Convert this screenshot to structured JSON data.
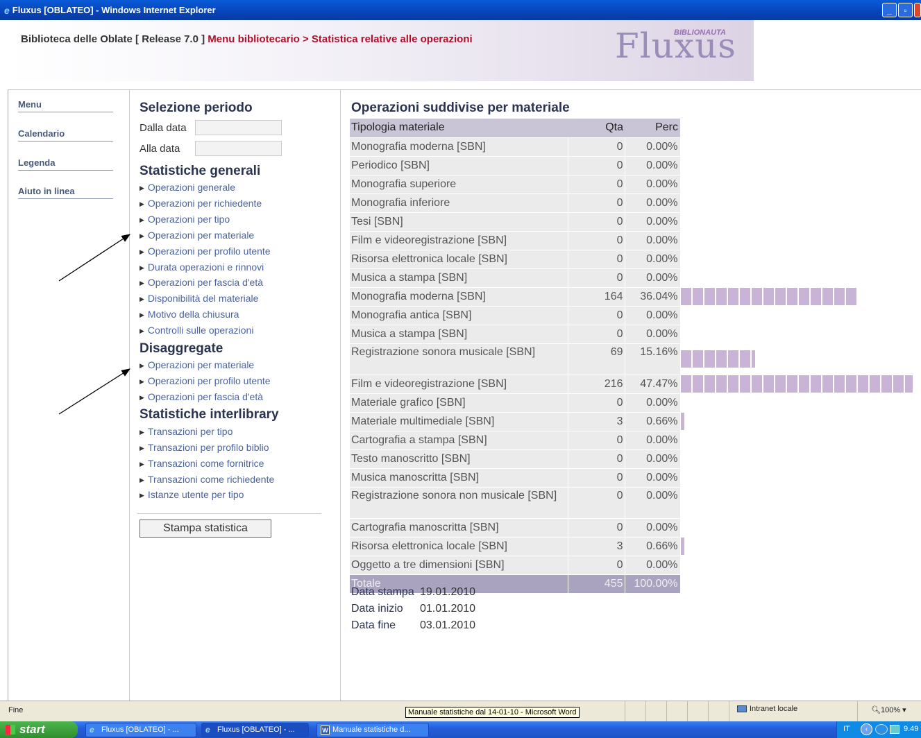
{
  "window": {
    "title": "Fluxus [OBLATEO] - Windows Internet Explorer",
    "minimize_label": "_",
    "maximize_label": "▫"
  },
  "header": {
    "crumb_black": "Biblioteca delle Oblate [ Release 7.0 ]",
    "crumb_red": "Menu bibliotecario > Statistica relative alle operazioni",
    "logo_text": "Fluxus",
    "logo_sub": "BIBLIONAUTA"
  },
  "sidebar": {
    "items": [
      {
        "label": "Menu"
      },
      {
        "label": "Calendario"
      },
      {
        "label": "Legenda"
      },
      {
        "label": "Aiuto in linea"
      }
    ]
  },
  "nav": {
    "periodo": {
      "title": "Selezione periodo",
      "dalla_label": "Dalla data",
      "dalla_value": "",
      "alla_label": "Alla data",
      "alla_value": ""
    },
    "generali": {
      "title": "Statistiche generali",
      "links": [
        "Operazioni generale",
        "Operazioni per richiedente",
        "Operazioni per tipo",
        "Operazioni per materiale",
        "Operazioni per profilo utente",
        "Durata operazioni e rinnovi",
        "Operazioni per fascia d'età",
        "Disponibilità del materiale",
        "Motivo della chiusura",
        "Controlli sulle operazioni"
      ]
    },
    "disaggregate": {
      "title": "Disaggregate",
      "links": [
        "Operazioni per materiale",
        "Operazioni per profilo utente",
        "Operazioni per fascia d'età"
      ]
    },
    "interlibrary": {
      "title": "Statistiche interlibrary",
      "links": [
        "Transazioni per tipo",
        "Transazioni per profilo biblio",
        "Transazioni come fornitrice",
        "Transazioni come richiedente",
        "Istanze utente per tipo"
      ]
    },
    "print_button": "Stampa statistica"
  },
  "content": {
    "title": "Operazioni suddivise per materiale",
    "columns": [
      "Tipologia materiale",
      "Qta",
      "Perc"
    ],
    "rows": [
      {
        "name": "Monografia moderna [SBN]",
        "qta": "0",
        "perc": "0.00%",
        "bar": 0
      },
      {
        "name": "Periodico [SBN]",
        "qta": "0",
        "perc": "0.00%",
        "bar": 0
      },
      {
        "name": "Monografia superiore",
        "qta": "0",
        "perc": "0.00%",
        "bar": 0
      },
      {
        "name": "Monografia inferiore",
        "qta": "0",
        "perc": "0.00%",
        "bar": 0
      },
      {
        "name": "Tesi [SBN]",
        "qta": "0",
        "perc": "0.00%",
        "bar": 0
      },
      {
        "name": "Film e videoregistrazione [SBN]",
        "qta": "0",
        "perc": "0.00%",
        "bar": 0
      },
      {
        "name": "Risorsa elettronica locale [SBN]",
        "qta": "0",
        "perc": "0.00%",
        "bar": 0
      },
      {
        "name": "Musica a stampa [SBN]",
        "qta": "0",
        "perc": "0.00%",
        "bar": 0
      },
      {
        "name": "Monografia moderna [SBN]",
        "qta": "164",
        "perc": "36.04%",
        "bar": 36.04
      },
      {
        "name": "Monografia antica [SBN]",
        "qta": "0",
        "perc": "0.00%",
        "bar": 0
      },
      {
        "name": "Musica a stampa [SBN]",
        "qta": "0",
        "perc": "0.00%",
        "bar": 0
      },
      {
        "name": "Registrazione sonora musicale [SBN]",
        "qta": "69",
        "perc": "15.16%",
        "bar": 15.16
      },
      {
        "name": "Film e videoregistrazione [SBN]",
        "qta": "216",
        "perc": "47.47%",
        "bar": 47.47
      },
      {
        "name": "Materiale grafico [SBN]",
        "qta": "0",
        "perc": "0.00%",
        "bar": 0
      },
      {
        "name": "Materiale multimediale [SBN]",
        "qta": "3",
        "perc": "0.66%",
        "bar": 0.66
      },
      {
        "name": "Cartografia a stampa [SBN]",
        "qta": "0",
        "perc": "0.00%",
        "bar": 0
      },
      {
        "name": "Testo manoscritto [SBN]",
        "qta": "0",
        "perc": "0.00%",
        "bar": 0
      },
      {
        "name": "Musica manoscritta [SBN]",
        "qta": "0",
        "perc": "0.00%",
        "bar": 0
      },
      {
        "name": "Registrazione sonora non musicale [SBN]",
        "qta": "0",
        "perc": "0.00%",
        "bar": 0
      },
      {
        "name": "Cartografia manoscritta [SBN]",
        "qta": "0",
        "perc": "0.00%",
        "bar": 0
      },
      {
        "name": "Risorsa elettronica locale [SBN]",
        "qta": "3",
        "perc": "0.66%",
        "bar": 0.66
      },
      {
        "name": "Oggetto a tre dimensioni [SBN]",
        "qta": "0",
        "perc": "0.00%",
        "bar": 0
      }
    ],
    "total": {
      "name": "Totale",
      "qta": "455",
      "perc": "100.00%"
    },
    "meta": [
      {
        "key": "Data stampa",
        "value": "19.01.2010"
      },
      {
        "key": "Data inizio",
        "value": "01.01.2010"
      },
      {
        "key": "Data fine",
        "value": "03.01.2010"
      }
    ],
    "bar_color": "#c9b4d8"
  },
  "statusbar": {
    "status": "Fine",
    "zone": "Intranet locale",
    "zoom": "100%",
    "tooltip": "Manuale statistiche dal 14-01-10 - Microsoft Word"
  },
  "taskbar": {
    "start": "start",
    "tasks": [
      "Fluxus [OBLATEO] - ...",
      "Fluxus [OBLATEO] - ...",
      "Manuale statistiche d..."
    ],
    "lang": "IT",
    "clock": "9.49"
  }
}
